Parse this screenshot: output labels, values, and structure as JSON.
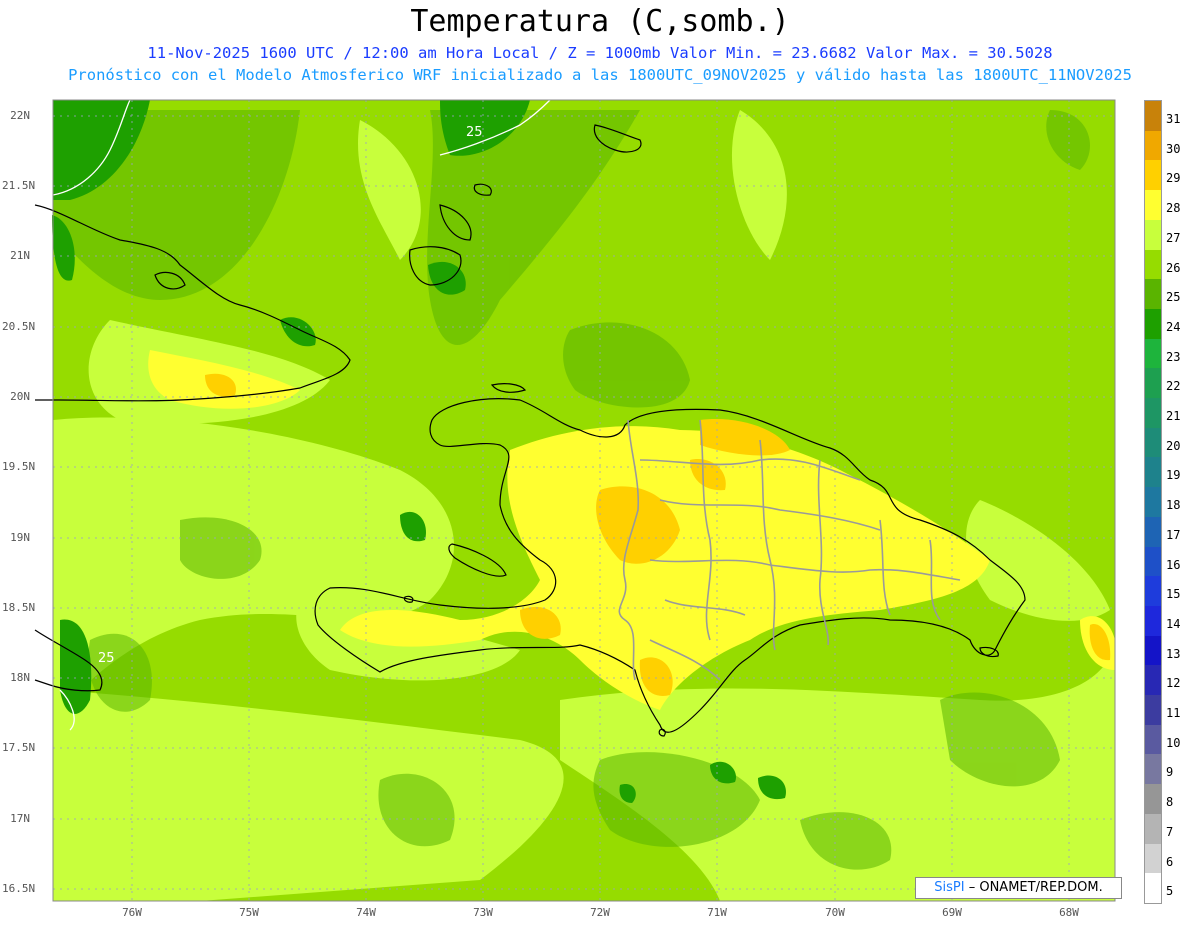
{
  "header": {
    "title": "Temperatura (C,somb.)",
    "line1": "11-Nov-2025 1600 UTC / 12:00 am Hora Local / Z = 1000mb  Valor Min. = 23.6682  Valor Max. = 30.5028",
    "line2": "Pronóstico con el Modelo Atmosferico WRF inicializado a las 1800UTC_09NOV2025 y válido hasta las  1800UTC_11NOV2025"
  },
  "axes": {
    "lat_labels": [
      "22N",
      "21.5N",
      "21N",
      "20.5N",
      "20N",
      "19.5N",
      "19N",
      "18.5N",
      "18N",
      "17.5N",
      "17N",
      "16.5N"
    ],
    "lon_labels": [
      "76W",
      "75W",
      "74W",
      "73W",
      "72W",
      "71W",
      "70W",
      "69W",
      "68W"
    ]
  },
  "contour_labels": [
    "25",
    "25"
  ],
  "colorbar": {
    "labels": [
      "31",
      "30",
      "29",
      "28",
      "27",
      "26",
      "25",
      "24",
      "23",
      "22",
      "21",
      "20",
      "19",
      "18",
      "17",
      "16",
      "15",
      "14",
      "13",
      "12",
      "11",
      "10",
      "9",
      "8",
      "7",
      "6",
      "5"
    ],
    "colors": [
      "#c8820a",
      "#f0a800",
      "#ffd000",
      "#ffff30",
      "#c8ff3c",
      "#96dc00",
      "#5ab400",
      "#1ea000",
      "#1eb43c",
      "#1ea050",
      "#1e9664",
      "#1e8c78",
      "#1e828c",
      "#1e78a0",
      "#1e64b4",
      "#1e50c8",
      "#1e3cdc",
      "#1e28dc",
      "#1414c8",
      "#2828b4",
      "#3c3ca0",
      "#5a5aa0",
      "#7878a0",
      "#969696",
      "#b4b4b4",
      "#d2d2d2",
      "#ffffff"
    ]
  },
  "credit": {
    "brand": "SisPI",
    "text": " – ONAMET/REP.DOM."
  }
}
